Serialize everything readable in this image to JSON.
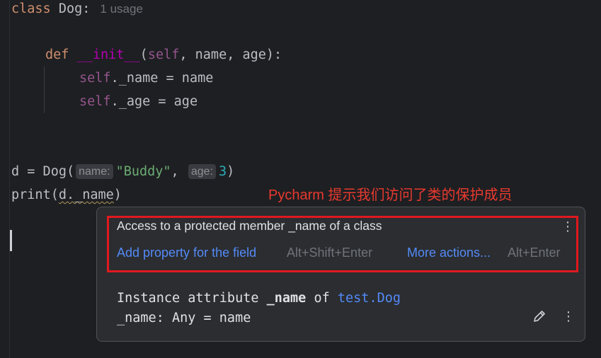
{
  "editor": {
    "lines": {
      "class_line": {
        "kw": "class",
        "name": "Dog:",
        "usage": "1 usage"
      },
      "def_line": {
        "kw": "def",
        "fn": "__init__",
        "open": "(",
        "self": "self",
        "rest": ", name, age):"
      },
      "assign_name": {
        "self": "self",
        "rest": "._name = name"
      },
      "assign_age": {
        "self": "self",
        "rest": "._age = age"
      },
      "d_line": {
        "prefix": "d = Dog(",
        "hint_name": "name:",
        "arg_name": "\"Buddy\"",
        "comma": ",",
        "hint_age": "age:",
        "arg_age": "3",
        "close": ")"
      },
      "print_line": {
        "prefix": "print(",
        "warn": "d._name",
        "close": ")"
      }
    }
  },
  "annotation": "Pycharm 提示我们访问了类的保护成员",
  "popup": {
    "problem": "Access to a protected member _name of a class",
    "action_primary": "Add property for the field",
    "action_primary_shortcut": "Alt+Shift+Enter",
    "action_more": "More actions...",
    "action_more_shortcut": "Alt+Enter",
    "doc": {
      "line1_prefix": "Instance attribute ",
      "line1_name": "_name",
      "line1_of": " of ",
      "line1_link": "test.Dog",
      "line2": "_name: Any = name"
    },
    "icons": [
      "more-vertical-icon",
      "pencil-icon"
    ]
  },
  "colors": {
    "background": "#1e1f22",
    "keyword": "#cf8e6d",
    "dunder": "#b200b2",
    "self": "#94558d",
    "string": "#6aab73",
    "number": "#2aacb8",
    "link": "#548af7",
    "highlight_box": "#e0191f",
    "annotation": "#e8392f"
  }
}
